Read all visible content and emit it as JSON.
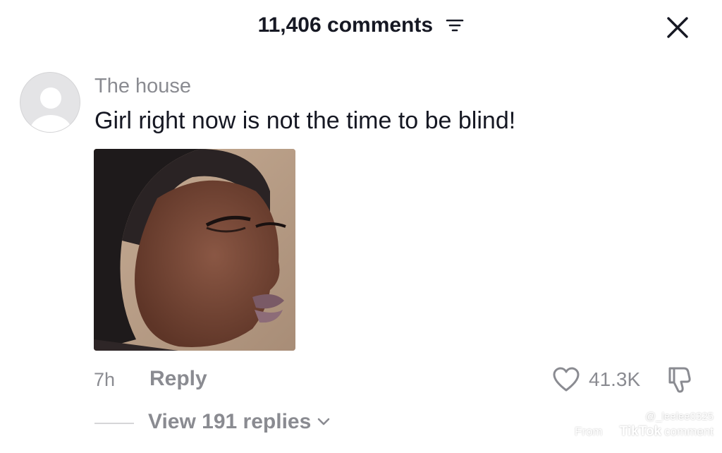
{
  "header": {
    "title": "11,406 comments",
    "filter_icon": "filter-lines-icon",
    "close_icon": "close-icon"
  },
  "comment": {
    "username": "The house",
    "text": "Girl right now is not the time to be blind!",
    "avatar_icon": "default-avatar-icon",
    "timestamp": "7h",
    "reply_label": "Reply",
    "like_count": "41.3K",
    "like_icon": "heart-outline-icon",
    "dislike_icon": "thumbs-down-icon",
    "view_replies_label": "View 191 replies",
    "chevron_icon": "chevron-down-icon"
  },
  "watermark": {
    "handle": "@_leelee0325",
    "from_label": "From",
    "brand": "TikTok",
    "suffix": "comment"
  },
  "colors": {
    "primary_text": "#161823",
    "secondary_text": "#8a8b91",
    "background": "#ffffff"
  }
}
